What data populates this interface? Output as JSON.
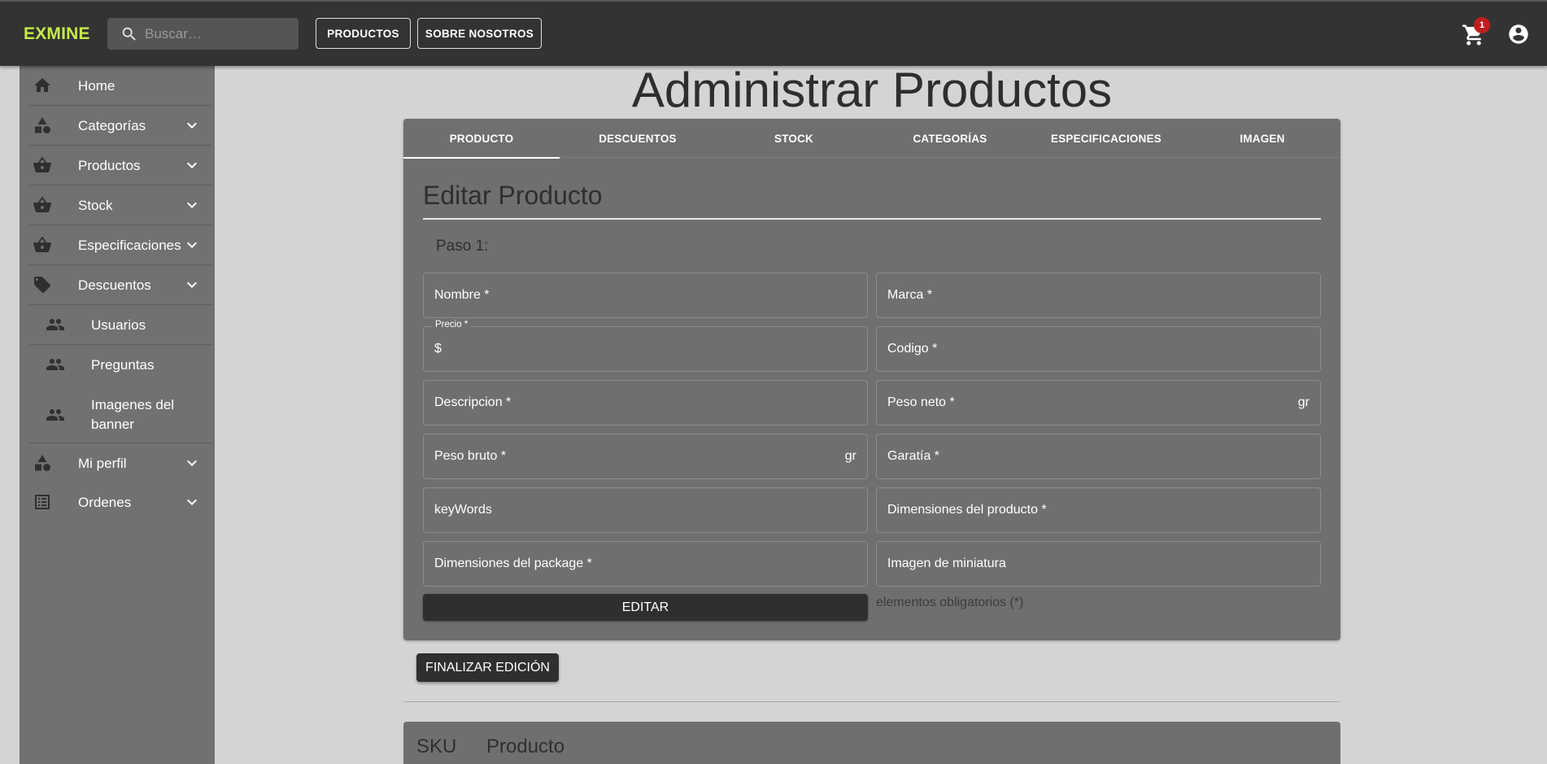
{
  "header": {
    "logo": "EXMINE",
    "search_placeholder": "Buscar…",
    "nav": [
      "PRODUCTOS",
      "SOBRE NOSOTROS"
    ],
    "cart_count": "1"
  },
  "sidebar": {
    "items": [
      {
        "label": "Home",
        "icon": "home-icon"
      },
      {
        "label": "Categorías",
        "icon": "category-icon"
      },
      {
        "label": "Productos",
        "icon": "basket-icon"
      },
      {
        "label": "Stock",
        "icon": "basket-icon"
      },
      {
        "label": "Especificaciones",
        "icon": "basket-icon"
      },
      {
        "label": "Descuentos",
        "icon": "tag-icon"
      },
      {
        "label": "Usuarios",
        "icon": "people-icon"
      },
      {
        "label": "Preguntas",
        "icon": "people-icon"
      },
      {
        "label": "Imagenes del banner",
        "icon": "people-icon"
      },
      {
        "label": "Mi perfil",
        "icon": "category-icon"
      },
      {
        "label": "Ordenes",
        "icon": "list-icon"
      }
    ]
  },
  "main": {
    "title": "Administrar Productos",
    "tabs": [
      "PRODUCTO",
      "DESCUENTOS",
      "STOCK",
      "CATEGORÍAS",
      "ESPECIFICACIONES",
      "IMAGEN"
    ],
    "form": {
      "title": "Editar Producto",
      "step": "Paso 1:",
      "fields": {
        "nombre": "Nombre *",
        "marca": "Marca *",
        "precio_label": "Precio *",
        "precio_prefix": "$",
        "codigo": "Codigo *",
        "descripcion": "Descripcion *",
        "peso_neto": "Peso neto *",
        "peso_bruto": "Peso bruto *",
        "garantia": "Garatía *",
        "keywords": "keyWords",
        "dim_producto": "Dimensiones del producto *",
        "dim_package": "Dimensiones del package *",
        "imagen_miniatura": "Imagen de miniatura",
        "unit": "gr"
      },
      "submit": "EDITAR",
      "required_note": "elementos obligatorios (*)"
    },
    "finalize": "FINALIZAR EDICIÓN",
    "table_headers": [
      "SKU",
      "Producto"
    ]
  }
}
